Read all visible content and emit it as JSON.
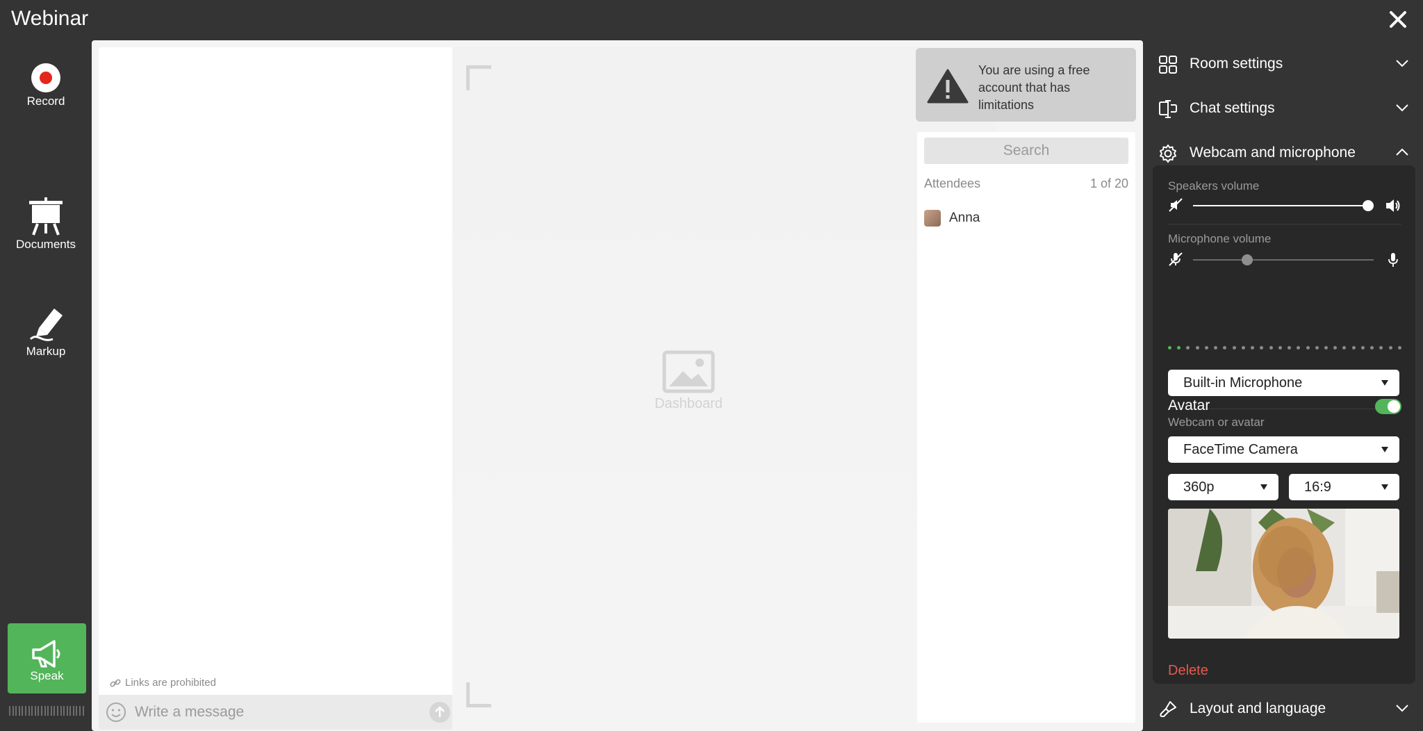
{
  "app": {
    "title": "Webinar"
  },
  "toolbar": {
    "record_label": "Record",
    "documents_label": "Documents",
    "markup_label": "Markup",
    "speak_label": "Speak",
    "speak_color": "#52b55a"
  },
  "chat": {
    "links_note": "Links are prohibited",
    "placeholder": "Write a message"
  },
  "dashboard": {
    "placeholder_label": "Dashboard"
  },
  "warning": {
    "text": "You are using a free account that has limitations"
  },
  "attendees": {
    "search_placeholder": "Search",
    "header_label": "Attendees",
    "count": "1 of 20",
    "list": [
      {
        "name": "Anna"
      }
    ]
  },
  "settings": {
    "room_settings": "Room settings",
    "chat_settings": "Chat settings",
    "webcam_microphone": "Webcam and microphone",
    "layout_language": "Layout and language"
  },
  "webcam_panel": {
    "speakers_label": "Speakers volume",
    "speakers_level": 1.0,
    "microphone_label": "Microphone volume",
    "microphone_level": 0.3,
    "mic_active_dots": 2,
    "mic_device": "Built-in Microphone",
    "webcam_label": "Webcam or avatar",
    "avatar_label": "Avatar",
    "avatar_enabled": true,
    "camera_device": "FaceTime Camera",
    "resolution": "360p",
    "aspect": "16:9",
    "delete_label": "Delete",
    "accent_color": "#53b55b",
    "delete_color": "#e55a50"
  }
}
